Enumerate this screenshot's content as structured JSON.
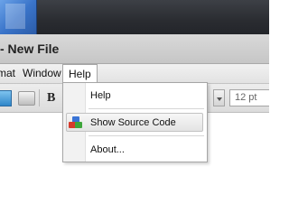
{
  "window": {
    "title": "- New File"
  },
  "menubar": {
    "items": [
      {
        "label": "mat"
      },
      {
        "label": "Window"
      },
      {
        "label": "Help"
      }
    ]
  },
  "toolbar": {
    "bold_label": "B",
    "font_size_value": "12 pt"
  },
  "help_menu": {
    "items": [
      {
        "label": "Help"
      },
      {
        "label": "Show Source Code",
        "icon": "source-code-icon",
        "highlighted": true
      },
      {
        "label": "About..."
      }
    ]
  }
}
